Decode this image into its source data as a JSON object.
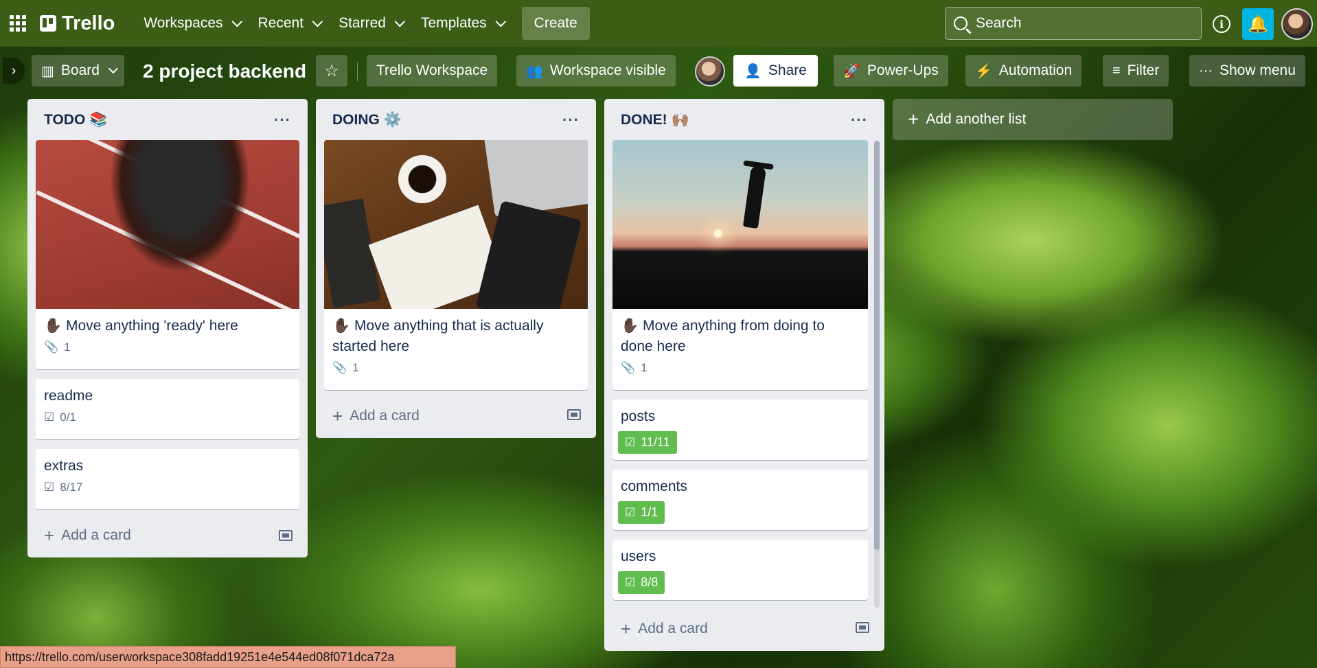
{
  "topbar": {
    "logo_text": "Trello",
    "nav": [
      "Workspaces",
      "Recent",
      "Starred",
      "Templates"
    ],
    "create_label": "Create",
    "search_placeholder": "Search",
    "info_glyph": "i",
    "bell_glyph": "🔔"
  },
  "boardbar": {
    "view_label": "Board",
    "board_title": "2 project backend",
    "star_glyph": "☆",
    "workspace_label": "Trello Workspace",
    "visibility_label": "Workspace visible",
    "share_label": "Share",
    "powerups_label": "Power-Ups",
    "automation_label": "Automation",
    "filter_label": "Filter",
    "show_menu_label": "Show menu",
    "expander_glyph": "›"
  },
  "lists": [
    {
      "title": "TODO 📚",
      "cards": [
        {
          "title": "✋🏿 Move anything 'ready' here",
          "attachments": "1",
          "cover": "track"
        },
        {
          "title": "readme",
          "checklist": "0/1"
        },
        {
          "title": "extras",
          "checklist": "8/17"
        }
      ],
      "add_card": "Add a card"
    },
    {
      "title": "DOING ⚙️",
      "cards": [
        {
          "title": "✋🏿 Move anything that is actually started here",
          "attachments": "1",
          "cover": "desk"
        }
      ],
      "add_card": "Add a card"
    },
    {
      "title": "DONE! 🙌🏽",
      "cards": [
        {
          "title": "✋🏿 Move anything from doing to done here",
          "attachments": "1",
          "cover": "sunset"
        },
        {
          "title": "posts",
          "checklist": "11/11",
          "complete": true
        },
        {
          "title": "comments",
          "checklist": "1/1",
          "complete": true
        },
        {
          "title": "users",
          "checklist": "8/8",
          "complete": true
        }
      ],
      "add_card": "Add a card"
    }
  ],
  "add_list_label": "Add another list",
  "status_url": "https://trello.com/userworkspace308fadd19251e4e544ed08f071dca72a",
  "colors": {
    "nav_bg": "#3b5d16",
    "list_bg": "#ebecf0",
    "complete_green": "#61bd4f",
    "bell_bg": "#00b5e2"
  },
  "icons": {
    "menu_dots": "···",
    "plus": "+",
    "paperclip": "📎",
    "checkbox": "☑",
    "share_user": "👤",
    "rocket": "🚀",
    "bolt": "⚡",
    "filter": "≡",
    "visible": "👥"
  }
}
